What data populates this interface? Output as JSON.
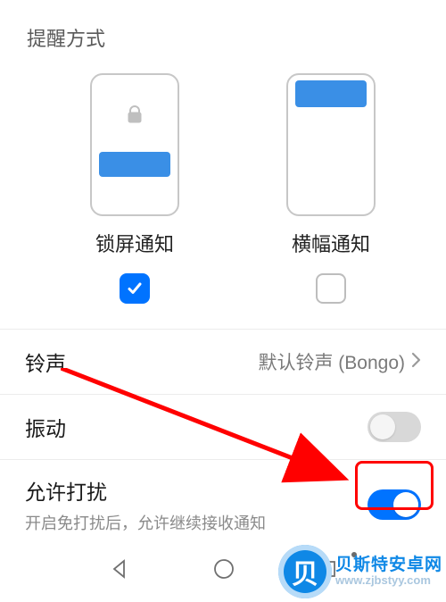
{
  "section_title": "提醒方式",
  "options": {
    "lockscreen": {
      "label": "锁屏通知",
      "checked": true
    },
    "banner": {
      "label": "横幅通知",
      "checked": false
    }
  },
  "rows": {
    "ringtone": {
      "label": "铃声",
      "value": "默认铃声 (Bongo)"
    },
    "vibrate": {
      "label": "振动",
      "on": false
    },
    "allow_interrupt": {
      "label": "允许打扰",
      "sub": "开启免打扰后，允许继续接收通知",
      "on": true
    }
  },
  "watermark": {
    "line1": "贝斯特安卓网",
    "line2": "www.zjbstyy.com",
    "badge": "贝"
  },
  "colors": {
    "accent": "#0073ff",
    "highlight": "#ff0000"
  }
}
